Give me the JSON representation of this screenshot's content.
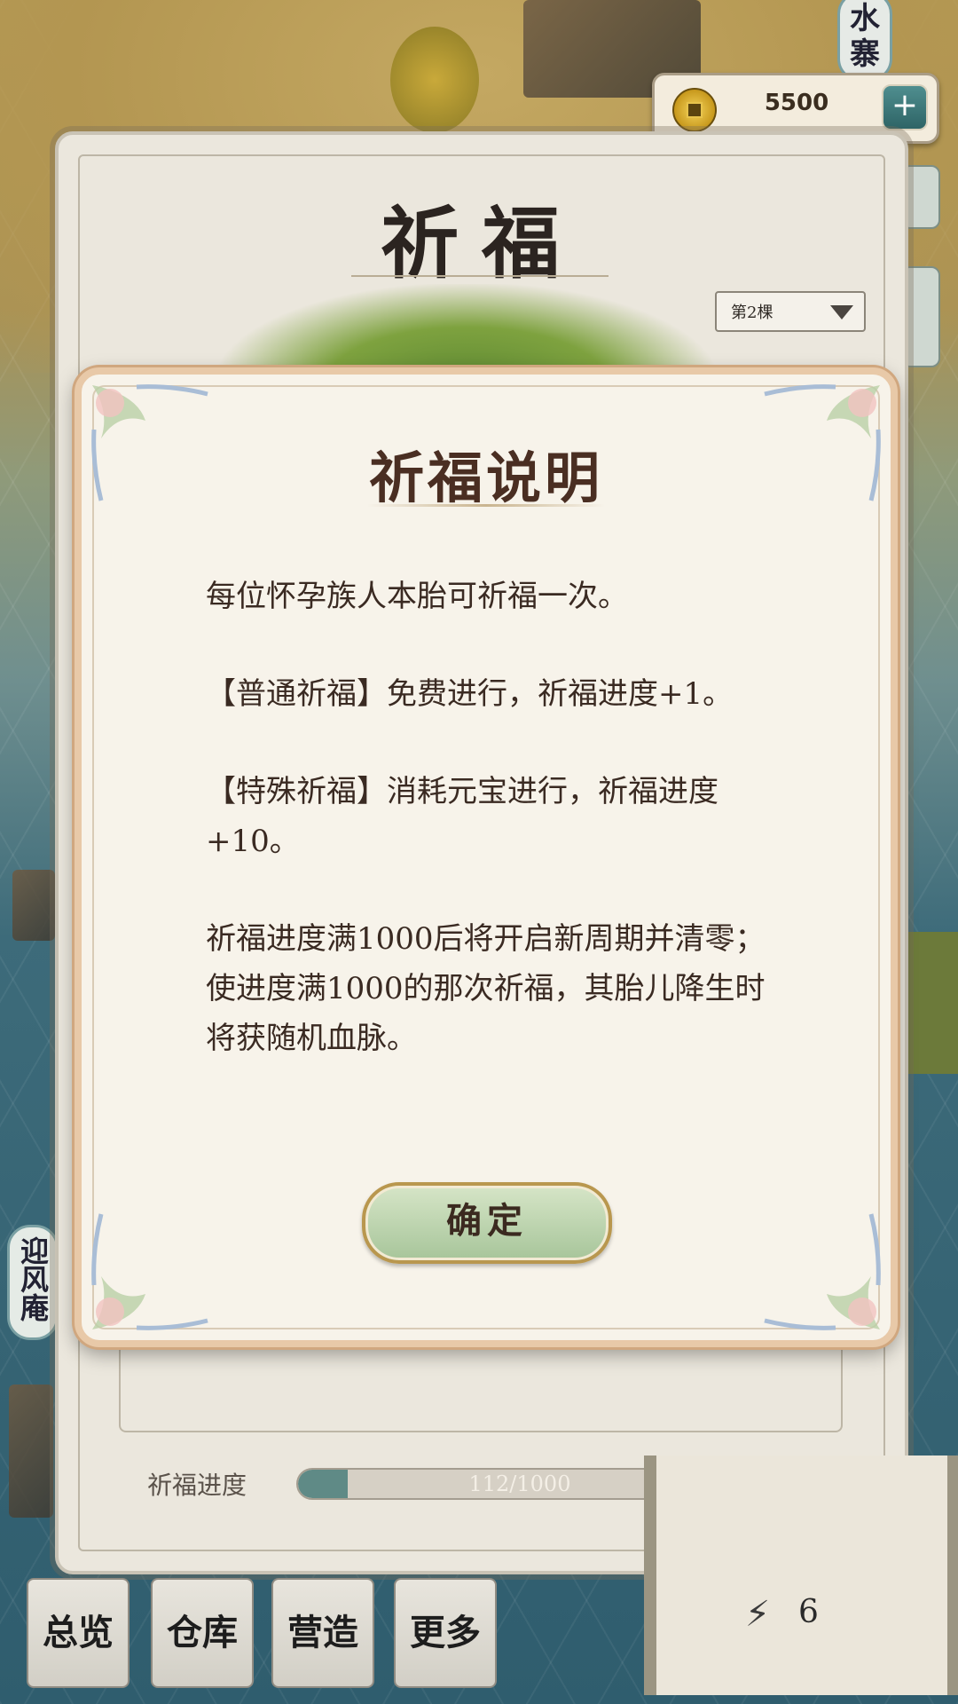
{
  "hud": {
    "gold_value": "5500",
    "gold_plus": "+",
    "top_place_label": "水寨",
    "side_place_label": "迎风庵"
  },
  "panel": {
    "title": "祈福",
    "tree_select": "第2棵",
    "progress_label": "祈福进度",
    "progress_text": "112/1000",
    "progress_value": 112,
    "progress_max": 1000,
    "help_label": "?"
  },
  "dialog": {
    "title": "祈福说明",
    "paragraphs": [
      "每位怀孕族人本胎可祈福一次。",
      "【普通祈福】免费进行，祈福进度+1。",
      "【特殊祈福】消耗元宝进行，祈福进度+10。",
      "祈福进度满1000后将开启新周期并清零；使进度满1000的那次祈福，其胎儿降生时将获随机血脉。"
    ],
    "confirm_label": "确定"
  },
  "nav": {
    "overview": "总览",
    "warehouse": "仓库",
    "build": "营造",
    "more": "更多"
  },
  "status": {
    "energy_value": "6"
  },
  "colors": {
    "dialog_border": "#e8c9a8",
    "confirm_bg": "#a7c59a",
    "progress_fill": "#5f8a86"
  }
}
